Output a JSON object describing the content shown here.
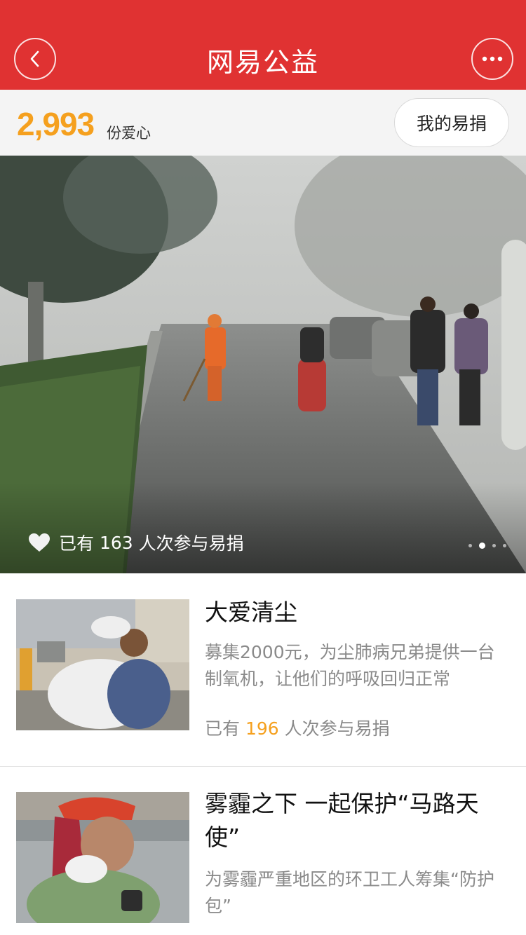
{
  "header": {
    "title": "网易公益",
    "back_icon": "chevron-left-icon",
    "more_icon": "more-dots-icon",
    "color": "#e03232"
  },
  "stats": {
    "love_count": "2,993",
    "love_unit": "份爱心",
    "my_donation_label": "我的易捐",
    "accent_color": "#f5a01e"
  },
  "banner": {
    "participants_prefix": "已有",
    "participants_count": "163",
    "participants_suffix": "人次参与易捐",
    "heart_icon": "heart-icon",
    "page_count": 4,
    "active_page": 2
  },
  "projects": [
    {
      "title": "大爱清尘",
      "description": "募集2000元，为尘肺病兄弟提供一台制氧机，让他们的呼吸回归正常",
      "participants_prefix": "已有",
      "participants_count": "196",
      "participants_suffix": "人次参与易捐"
    },
    {
      "title": "雾霾之下 一起保护“马路天使”",
      "description": "为雾霾严重地区的环卫工人筹集“防护包”"
    }
  ]
}
